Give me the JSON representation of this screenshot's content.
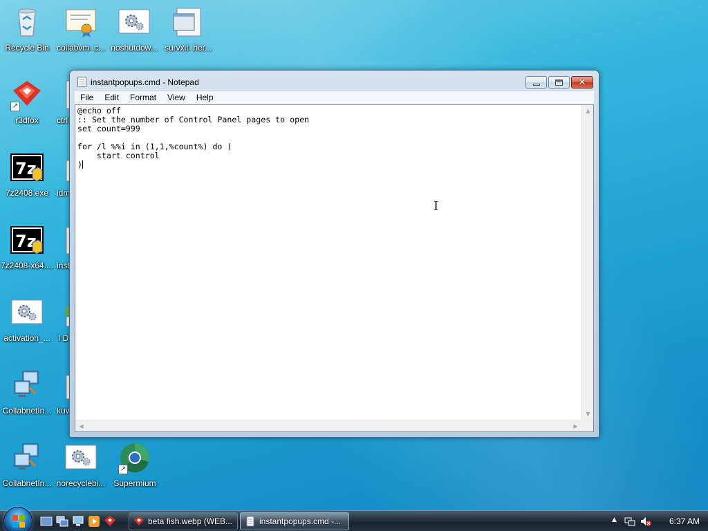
{
  "desktop": {
    "icons": [
      {
        "label": "Recycle Bin",
        "icon": "recycle-bin-icon"
      },
      {
        "label": "collabvm_c...",
        "icon": "certificate-icon"
      },
      {
        "label": "noshutdow...",
        "icon": "gear-script-icon"
      },
      {
        "label": "survxit_her...",
        "icon": "window-file-icon"
      },
      {
        "label": "r3dfox",
        "icon": "red-fox-browser-icon"
      },
      {
        "label": "ctrl",
        "icon": "file-icon"
      },
      {
        "label": "7z2408.exe",
        "icon": "7zip-installer-icon"
      },
      {
        "label": "idm",
        "icon": "file-icon"
      },
      {
        "label": "7z2408-x64....",
        "icon": "7zip-installer-icon"
      },
      {
        "label": "inst",
        "icon": "file-icon"
      },
      {
        "label": "activation_...",
        "icon": "gear-script-icon"
      },
      {
        "label": "I D",
        "icon": "file-icon"
      },
      {
        "label": "CollabnetIn...",
        "icon": "network-computer-icon"
      },
      {
        "label": "kuv",
        "icon": "file-icon"
      },
      {
        "label": "CollabnetIn...",
        "icon": "network-computer-icon"
      },
      {
        "label": "norecyclebi...",
        "icon": "gear-script-icon"
      },
      {
        "label": "Supermium",
        "icon": "supermium-browser-icon"
      }
    ]
  },
  "window": {
    "title": "instantpopups.cmd - Notepad",
    "menu": [
      "File",
      "Edit",
      "Format",
      "View",
      "Help"
    ],
    "content": "@echo off\n:: Set the number of Control Panel pages to open\nset count=999\n\nfor /l %%i in (1,1,%count%) do (\n    start control\n)"
  },
  "taskbar": {
    "buttons": [
      {
        "label": "beta fish.webp (WEB...",
        "icon": "red-fox-browser-icon"
      },
      {
        "label": "instantpopups.cmd -...",
        "icon": "notepad-icon"
      }
    ],
    "clock": "6:37 AM"
  },
  "colors": {
    "desktop_accent": "#1d9fd2",
    "close_button": "#c23a20",
    "taskbar": "#1a2430"
  }
}
